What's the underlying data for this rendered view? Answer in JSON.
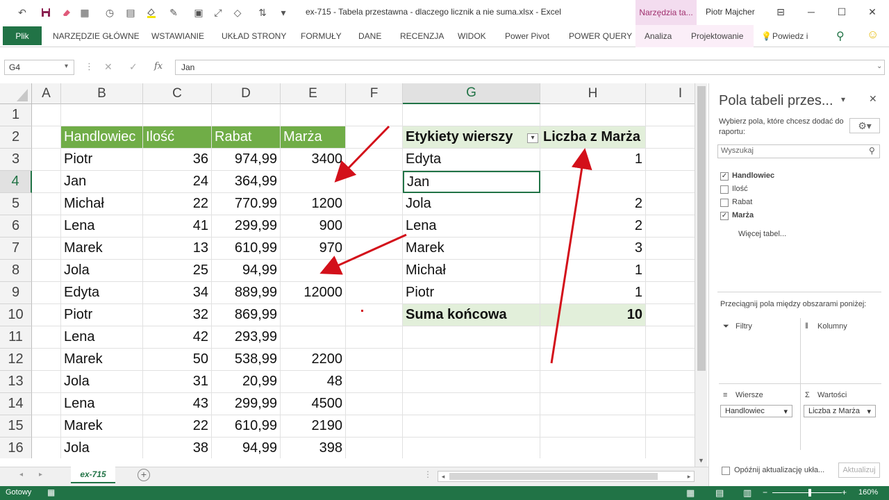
{
  "window": {
    "title": "ex-715 - Tabela przestawna - dlaczego licznik a nie suma.xlsx  -  Excel",
    "context_tab_title": "Narzędzia ta...",
    "user": "Piotr Majcher"
  },
  "ribbon": {
    "file": "Plik",
    "tabs": [
      "NARZĘDZIE GŁÓWNE",
      "WSTAWIANIE",
      "UKŁAD STRONY",
      "FORMUŁY",
      "DANE",
      "RECENZJA",
      "WIDOK",
      "Power Pivot",
      "POWER QUERY"
    ],
    "context_tabs": [
      "Analiza",
      "Projektowanie"
    ],
    "tell_me": "Powiedz i"
  },
  "formula_bar": {
    "name_box": "G4",
    "formula": "Jan",
    "fx": "fx"
  },
  "columns": [
    "A",
    "B",
    "C",
    "D",
    "E",
    "F",
    "G",
    "H",
    "I"
  ],
  "rows": [
    "1",
    "2",
    "3",
    "4",
    "5",
    "6",
    "7",
    "8",
    "9",
    "10",
    "11",
    "12",
    "13",
    "14",
    "15",
    "16"
  ],
  "table": {
    "headers": [
      "Handlowiec",
      "Ilość",
      "Rabat",
      "Marża"
    ],
    "rows": [
      [
        "Piotr",
        "36",
        "974,99",
        "3400"
      ],
      [
        "Jan",
        "24",
        "364,99",
        ""
      ],
      [
        "Michał",
        "22",
        "770.99",
        "1200"
      ],
      [
        "Lena",
        "41",
        "299,99",
        "900"
      ],
      [
        "Marek",
        "13",
        "610,99",
        "970"
      ],
      [
        "Jola",
        "25",
        "94,99",
        ""
      ],
      [
        "Edyta",
        "34",
        "889,99",
        "12000"
      ],
      [
        "Piotr",
        "32",
        "869,99",
        ""
      ],
      [
        "Lena",
        "42",
        "293,99",
        ""
      ],
      [
        "Marek",
        "50",
        "538,99",
        "2200"
      ],
      [
        "Jola",
        "31",
        "20,99",
        "48"
      ],
      [
        "Lena",
        "43",
        "299,99",
        "4500"
      ],
      [
        "Marek",
        "22",
        "610,99",
        "2190"
      ],
      [
        "Jola",
        "38",
        "94,99",
        "398"
      ]
    ]
  },
  "pivot": {
    "row_label_header": "Etykiety wierszy",
    "value_header": "Liczba z Marża",
    "rows": [
      [
        "Edyta",
        "1"
      ],
      [
        "Jan",
        ""
      ],
      [
        "Jola",
        "2"
      ],
      [
        "Lena",
        "2"
      ],
      [
        "Marek",
        "3"
      ],
      [
        "Michał",
        "1"
      ],
      [
        "Piotr",
        "1"
      ]
    ],
    "total_label": "Suma końcowa",
    "total_value": "10"
  },
  "sheet_tabs": [
    "ex-715"
  ],
  "status": {
    "ready": "Gotowy",
    "zoom": "160%"
  },
  "pane": {
    "title": "Pola tabeli przes...",
    "subtitle": "Wybierz pola, które chcesz dodać do raportu:",
    "search_placeholder": "Wyszukaj",
    "fields": [
      {
        "label": "Handlowiec",
        "checked": true
      },
      {
        "label": "Ilość",
        "checked": false
      },
      {
        "label": "Rabat",
        "checked": false
      },
      {
        "label": "Marża",
        "checked": true
      }
    ],
    "more_tables": "Więcej tabel...",
    "drag_hint": "Przeciągnij pola między obszarami poniżej:",
    "area_filters": "Filtry",
    "area_columns": "Kolumny",
    "area_rows": "Wiersze",
    "area_values": "Wartości",
    "rows_field": "Handlowiec",
    "values_field": "Liczba z Marża",
    "defer_label": "Opóźnij aktualizację ukła...",
    "update_button": "Aktualizuj"
  },
  "colors": {
    "excel_green": "#217346",
    "table_header": "#70ad47",
    "pivot_header": "#e2efda",
    "arrow": "#d3101a"
  }
}
